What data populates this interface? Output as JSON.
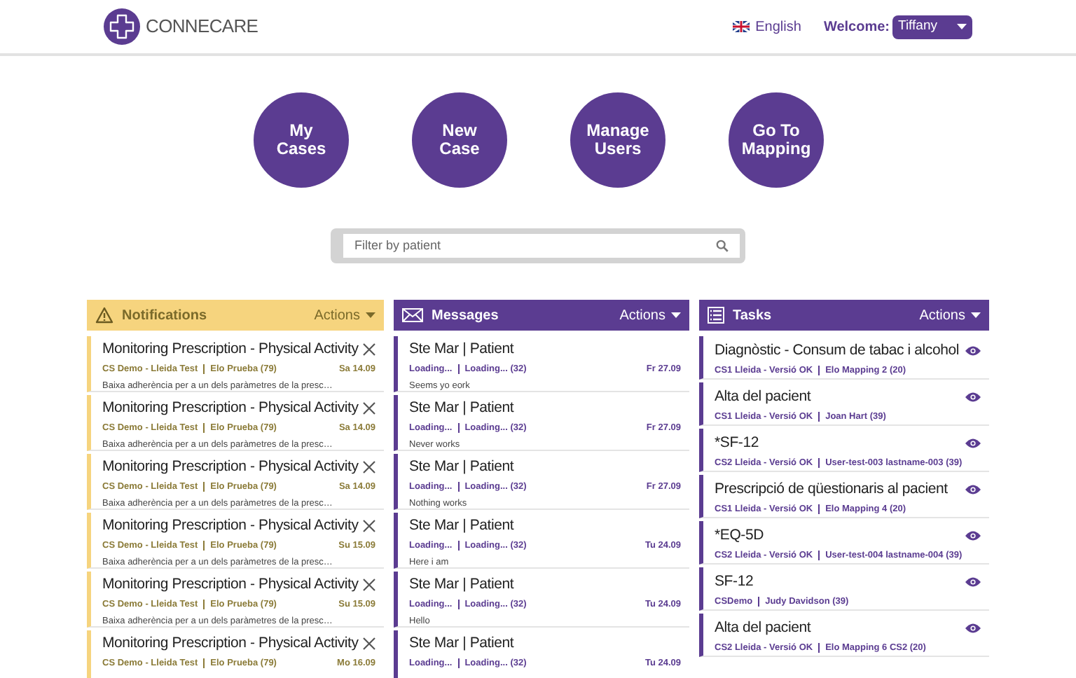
{
  "header": {
    "logo_text": "CONNECARE",
    "language": "English",
    "welcome_label": "Welcome:",
    "user": "Tiffany"
  },
  "shortcuts": [
    {
      "label": "My Cases"
    },
    {
      "label": "New Case"
    },
    {
      "label": "Manage Users"
    },
    {
      "label": "Go To Mapping"
    }
  ],
  "search": {
    "placeholder": "Filter by patient"
  },
  "panels": [
    {
      "kind": "notifications",
      "title": "Notifications",
      "actions": "Actions",
      "items": [
        {
          "title": "Monitoring Prescription - Physical Activity",
          "org": "CS Demo - Lleida Test",
          "patient": "Elo Prueba (79)",
          "date": "Sa 14.09",
          "text": "Baixa adherència per a un dels paràmetres de la presc…"
        },
        {
          "title": "Monitoring Prescription - Physical Activity",
          "org": "CS Demo - Lleida Test",
          "patient": "Elo Prueba (79)",
          "date": "Sa 14.09",
          "text": "Baixa adherència per a un dels paràmetres de la presc…"
        },
        {
          "title": "Monitoring Prescription - Physical Activity",
          "org": "CS Demo - Lleida Test",
          "patient": "Elo Prueba (79)",
          "date": "Sa 14.09",
          "text": "Baixa adherència per a un dels paràmetres de la presc…"
        },
        {
          "title": "Monitoring Prescription - Physical Activity",
          "org": "CS Demo - Lleida Test",
          "patient": "Elo Prueba (79)",
          "date": "Su 15.09",
          "text": "Baixa adherència per a un dels paràmetres de la presc…"
        },
        {
          "title": "Monitoring Prescription - Physical Activity",
          "org": "CS Demo - Lleida Test",
          "patient": "Elo Prueba (79)",
          "date": "Su 15.09",
          "text": "Baixa adherència per a un dels paràmetres de la presc…"
        },
        {
          "title": "Monitoring Prescription - Physical Activity",
          "org": "CS Demo - Lleida Test",
          "patient": "Elo Prueba (79)",
          "date": "Mo 16.09"
        }
      ]
    },
    {
      "kind": "messages",
      "title": "Messages",
      "actions": "Actions",
      "items": [
        {
          "title": "Ste Mar | Patient",
          "org": "Loading...",
          "patient": "Loading... (32)",
          "date": "Fr 27.09",
          "text": "Seems yo eork"
        },
        {
          "title": "Ste Mar | Patient",
          "org": "Loading...",
          "patient": "Loading... (32)",
          "date": "Fr 27.09",
          "text": "Never works"
        },
        {
          "title": "Ste Mar | Patient",
          "org": "Loading...",
          "patient": "Loading... (32)",
          "date": "Fr 27.09",
          "text": "Nothing works"
        },
        {
          "title": "Ste Mar | Patient",
          "org": "Loading...",
          "patient": "Loading... (32)",
          "date": "Tu 24.09",
          "text": "Here i am"
        },
        {
          "title": "Ste Mar | Patient",
          "org": "Loading...",
          "patient": "Loading... (32)",
          "date": "Tu 24.09",
          "text": "Hello"
        },
        {
          "title": "Ste Mar | Patient",
          "org": "Loading...",
          "patient": "Loading... (32)",
          "date": "Tu 24.09"
        }
      ]
    },
    {
      "kind": "tasks",
      "title": "Tasks",
      "actions": "Actions",
      "items": [
        {
          "title": "Diagnòstic - Consum de tabac i alcohol",
          "org": "CS1 Lleida - Versió OK",
          "patient": "Elo Mapping 2 (20)"
        },
        {
          "title": "Alta del pacient",
          "org": "CS1 Lleida - Versió OK",
          "patient": "Joan Hart (39)"
        },
        {
          "title": "*SF-12",
          "org": "CS2 Lleida - Versió OK",
          "patient": "User-test-003 lastname-003 (39)"
        },
        {
          "title": "Prescripció de qüestionaris al pacient",
          "org": "CS1 Lleida - Versió OK",
          "patient": "Elo Mapping 4 (20)"
        },
        {
          "title": "*EQ-5D",
          "org": "CS2 Lleida - Versió OK",
          "patient": "User-test-004 lastname-004 (39)"
        },
        {
          "title": "SF-12",
          "org": "CSDemo",
          "patient": "Judy Davidson (39)"
        },
        {
          "title": "Alta del pacient",
          "org": "CS2 Lleida - Versió OK",
          "patient": "Elo Mapping 6 CS2 (20)"
        }
      ]
    }
  ]
}
